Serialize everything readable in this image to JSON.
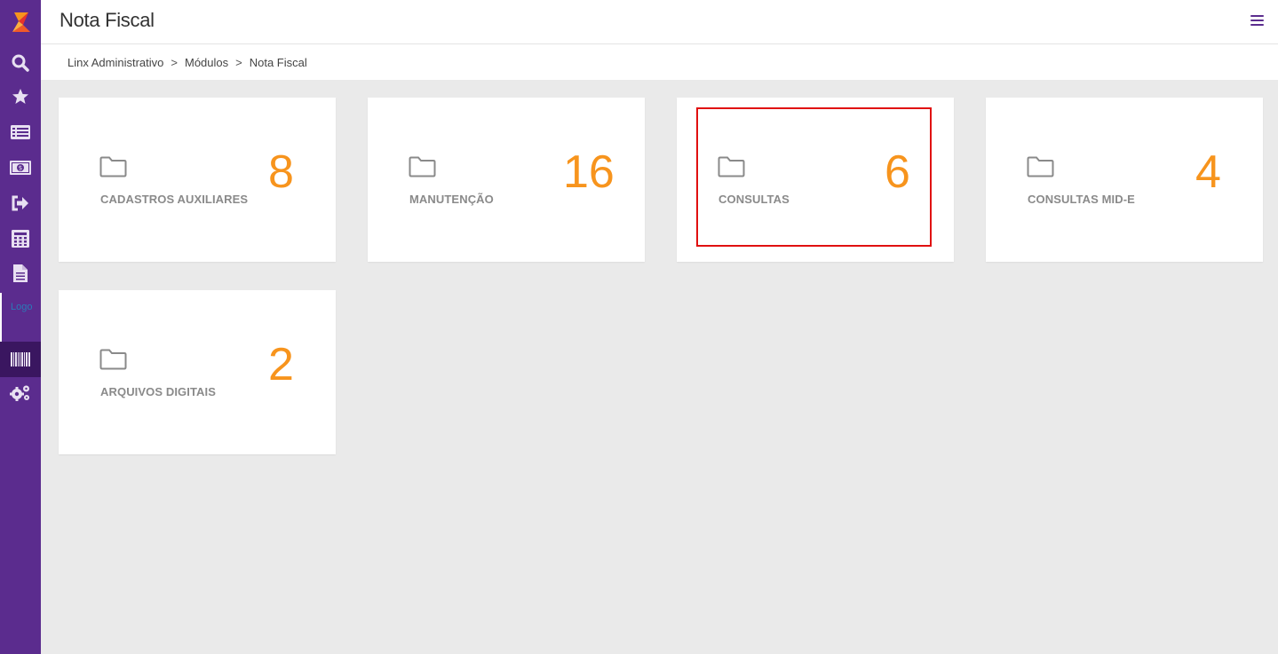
{
  "header": {
    "title": "Nota Fiscal"
  },
  "breadcrumb": [
    "Linx Administrativo",
    "Módulos",
    "Nota Fiscal"
  ],
  "breadcrumb_separator": ">",
  "sidebar": {
    "items": [
      {
        "icon": "search-icon"
      },
      {
        "icon": "star-icon"
      },
      {
        "icon": "list-icon"
      },
      {
        "icon": "money-icon"
      },
      {
        "icon": "sign-out-icon"
      },
      {
        "icon": "calculator-icon"
      },
      {
        "icon": "document-icon"
      },
      {
        "icon": "barcode-icon",
        "active": true
      },
      {
        "icon": "gears-icon"
      }
    ],
    "tooltip_fragment": "Logo"
  },
  "modules": [
    {
      "label": "CADASTROS AUXILIARES",
      "count": "8"
    },
    {
      "label": "MANUTENÇÃO",
      "count": "16"
    },
    {
      "label": "CONSULTAS",
      "count": "6",
      "highlighted": true
    },
    {
      "label": "CONSULTAS MID-E",
      "count": "4"
    },
    {
      "label": "ARQUIVOS DIGITAIS",
      "count": "2"
    }
  ],
  "colors": {
    "sidebar": "#5b2c8e",
    "accent_count": "#f7941d",
    "highlight": "#e01010",
    "background": "#eaeaea"
  }
}
